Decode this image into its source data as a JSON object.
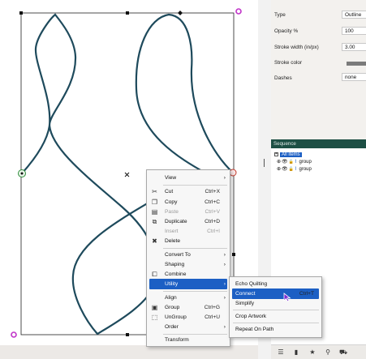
{
  "properties": {
    "rows": [
      {
        "label": "Type",
        "value": "Outline"
      },
      {
        "label": "Opacity %",
        "value": "100"
      },
      {
        "label": "Stroke width (in/px)",
        "value": "3.00"
      },
      {
        "label": "Stroke color",
        "value": ""
      },
      {
        "label": "Dashes",
        "value": "none"
      }
    ],
    "stroke_color": "#7b7b7b"
  },
  "sequence": {
    "title": "Sequence",
    "root_toggle": "+",
    "root": "All items",
    "items": [
      "group",
      "group"
    ]
  },
  "context_menu": {
    "view": "View",
    "cut": {
      "label": "Cut",
      "shortcut": "Ctrl+X"
    },
    "copy": {
      "label": "Copy",
      "shortcut": "Ctrl+C"
    },
    "paste": {
      "label": "Paste",
      "shortcut": "Ctrl+V"
    },
    "duplicate": {
      "label": "Duplicate",
      "shortcut": "Ctrl+D"
    },
    "insert": {
      "label": "Insert",
      "shortcut": "Ctrl+I"
    },
    "delete": "Delete",
    "convert_to": "Convert To",
    "shaping": "Shaping",
    "combine": "Combine",
    "utility": "Utility",
    "align": "Align",
    "group": {
      "label": "Group",
      "shortcut": "Ctrl+G"
    },
    "ungroup": {
      "label": "UnGroup",
      "shortcut": "Ctrl+U"
    },
    "order": "Order",
    "transform": "Transform"
  },
  "utility_submenu": {
    "echo_quilting": "Echo Quilting",
    "connect": {
      "label": "Connect",
      "shortcut": "Ctrl+T"
    },
    "simplify": "Simplify",
    "crop_artwork": "Crop Artwork",
    "repeat_on_path": "Repeat On Path"
  },
  "colors": {
    "curve": "#1e4a5c",
    "menu_highlight": "#1c5fc4",
    "sequence_header": "#1d4f44",
    "handle_magenta": "#c034c8"
  }
}
